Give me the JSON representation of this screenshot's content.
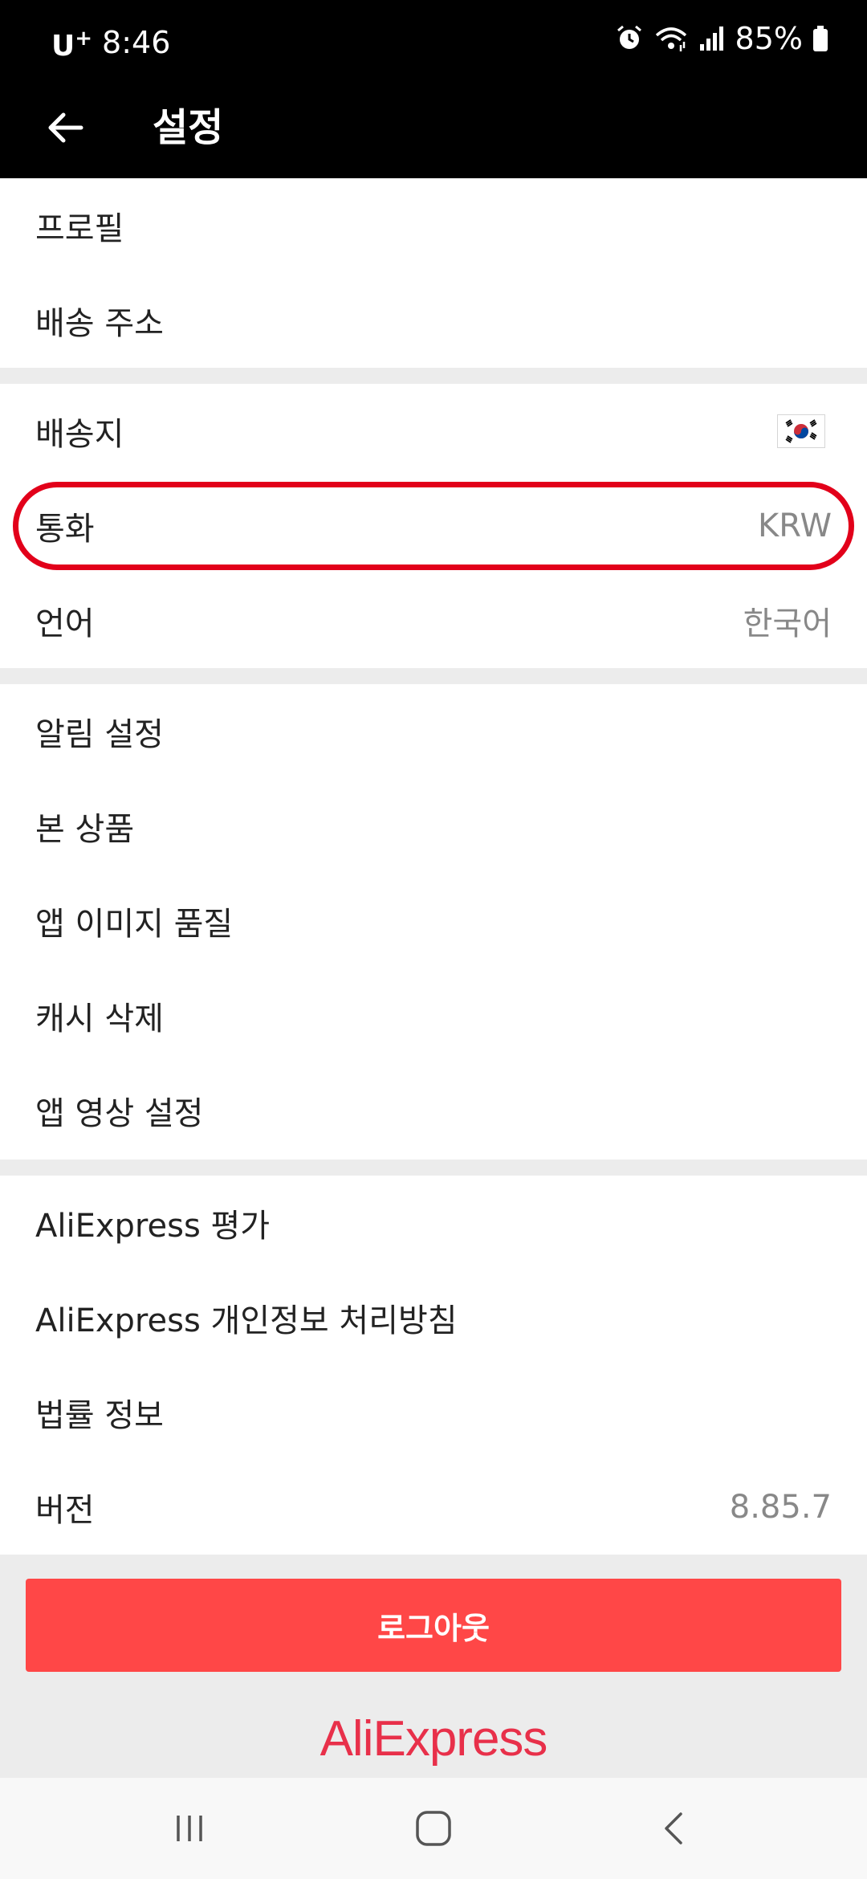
{
  "status_bar": {
    "carrier": "U",
    "carrier_sup": "+",
    "time": "8:46",
    "battery": "85%",
    "icons": [
      "alarm-icon",
      "wifi-icon",
      "signal-icon",
      "battery-icon"
    ]
  },
  "header": {
    "title": "설정",
    "back_icon": "back-arrow-icon"
  },
  "groups": {
    "account": {
      "items": [
        {
          "label": "프로필"
        },
        {
          "label": "배송 주소"
        }
      ]
    },
    "region": {
      "items": [
        {
          "label": "배송지",
          "value_icon": "korea-flag-icon"
        },
        {
          "label": "통화",
          "value": "KRW",
          "highlighted": true
        },
        {
          "label": "언어",
          "value": "한국어"
        }
      ]
    },
    "app": {
      "items": [
        {
          "label": "알림 설정"
        },
        {
          "label": "본 상품"
        },
        {
          "label": "앱 이미지 품질"
        },
        {
          "label": "캐시 삭제"
        },
        {
          "label": "앱 영상 설정"
        }
      ]
    },
    "about": {
      "items": [
        {
          "label": "AliExpress 평가"
        },
        {
          "label": "AliExpress 개인정보 처리방침"
        },
        {
          "label": "법률 정보"
        },
        {
          "label": "버전",
          "value": "8.85.7"
        }
      ]
    }
  },
  "logout_label": "로그아웃",
  "brand": "AliExpress",
  "colors": {
    "accent": "#ff4747",
    "brand": "#e8304a",
    "highlight": "#e2001a",
    "header_bg": "#000000"
  },
  "nav": [
    "recents-icon",
    "home-icon",
    "back-icon"
  ]
}
